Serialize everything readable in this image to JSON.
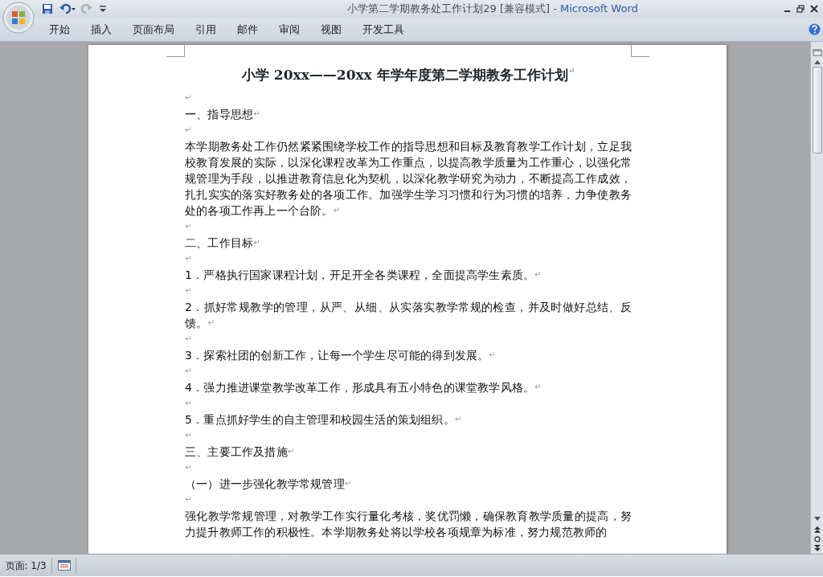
{
  "window": {
    "document_title": "小学第二学期教务处工作计划29 [兼容模式]",
    "app_title": "- Microsoft Word"
  },
  "ribbon_tabs": [
    {
      "label": "开始"
    },
    {
      "label": "插入"
    },
    {
      "label": "页面布局"
    },
    {
      "label": "引用"
    },
    {
      "label": "邮件"
    },
    {
      "label": "审阅"
    },
    {
      "label": "视图"
    },
    {
      "label": "开发工具"
    }
  ],
  "document": {
    "title": "小学 20xx——20xx 年学年度第二学期教务工作计划",
    "title_mark": "↵",
    "paragraphs": [
      {
        "mark": "↵"
      },
      {
        "text": "一、指导思想",
        "mark": "↵"
      },
      {
        "mark": "↵"
      },
      {
        "text": "本学期教务处工作仍然紧紧围绕学校工作的指导思想和目标及教育教学工作计划，立足我校教育发展的实际，以深化课程改革为工作重点，以提高教学质量为工作重心，以强化常规管理为手段，以推进教育信息化为契机，以深化教学研究为动力，不断提高工作成效，扎扎实实的落实好教务处的各项工作。加强学生学习习惯和行为习惯的培养，力争使教务处的各项工作再上一个台阶。",
        "mark": "↵"
      },
      {
        "mark": "↵"
      },
      {
        "text": "二、工作目标",
        "mark": "↵"
      },
      {
        "mark": "↵"
      },
      {
        "text": "1．严格执行国家课程计划，开足开全各类课程，全面提高学生素质。",
        "mark": "↵"
      },
      {
        "mark": "↵"
      },
      {
        "text": "2．抓好常规教学的管理，从严、从细、从实落实教学常规的检查，并及时做好总结、反馈。",
        "mark": "↵"
      },
      {
        "mark": "↵"
      },
      {
        "text": "3．探索社团的创新工作，让每一个学生尽可能的得到发展。",
        "mark": "↵"
      },
      {
        "mark": "↵"
      },
      {
        "text": "4．强力推进课堂教学改革工作，形成具有五小特色的课堂教学风格。",
        "mark": "↵"
      },
      {
        "mark": "↵"
      },
      {
        "text": "5．重点抓好学生的自主管理和校园生活的策划组织。",
        "mark": "↵"
      },
      {
        "mark": "↵"
      },
      {
        "text": "三、主要工作及措施",
        "mark": "↵"
      },
      {
        "mark": "↵"
      },
      {
        "text": "（一）进一步强化教学常规管理",
        "mark": "↵"
      },
      {
        "mark": "↵"
      },
      {
        "text": "强化教学常规管理，对教学工作实行量化考核，奖优罚懒，确保教育教学质量的提高，努力提升教师工作的积极性。本学期教务处将以学校各项规章为标准，努力规范教师的"
      }
    ]
  },
  "status_bar": {
    "page": "页面: 1/3"
  }
}
